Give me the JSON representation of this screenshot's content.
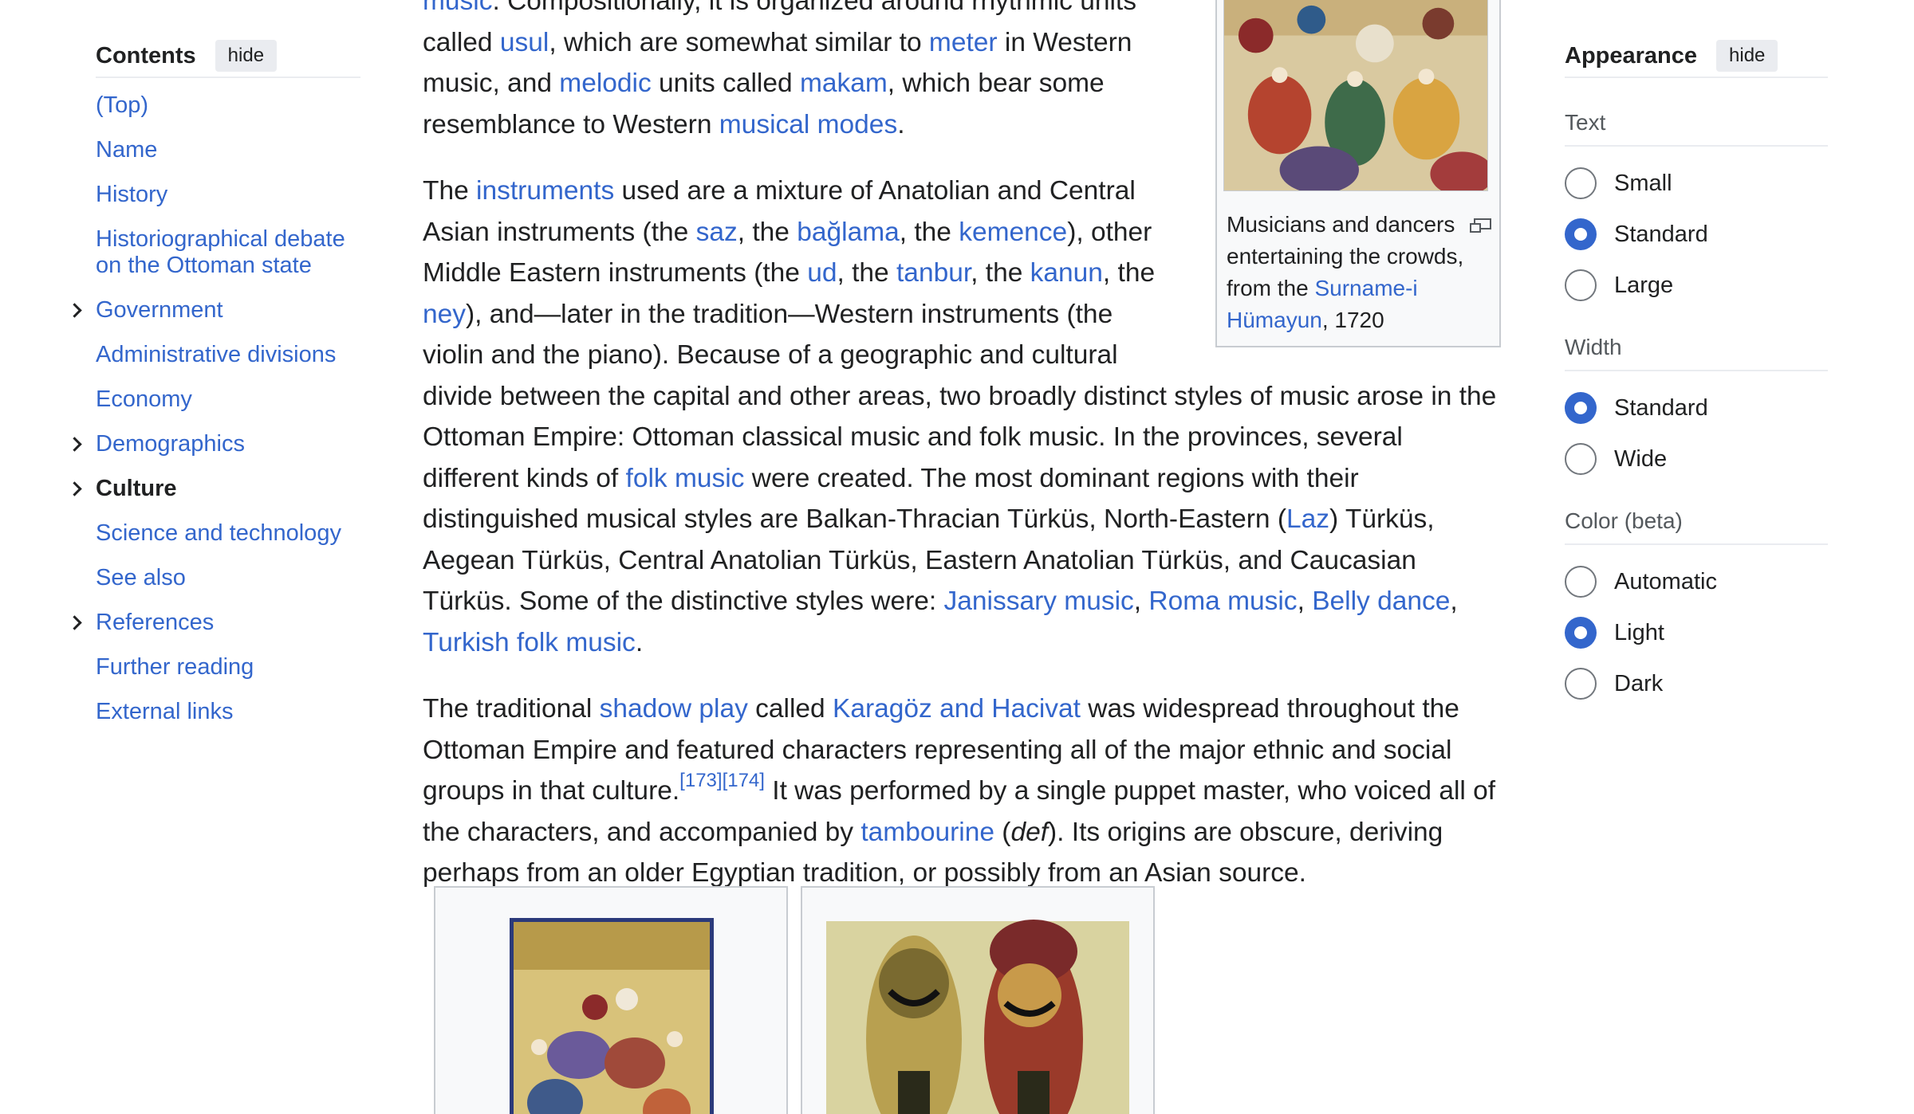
{
  "toc": {
    "title": "Contents",
    "hide_label": "hide",
    "items": [
      {
        "label": "(Top)"
      },
      {
        "label": "Name"
      },
      {
        "label": "History"
      },
      {
        "label": "Historiographical debate on the Ottoman state"
      },
      {
        "label": "Government"
      },
      {
        "label": "Administrative divisions"
      },
      {
        "label": "Economy"
      },
      {
        "label": "Demographics"
      },
      {
        "label": "Culture"
      },
      {
        "label": "Science and technology"
      },
      {
        "label": "See also"
      },
      {
        "label": "References"
      },
      {
        "label": "Further reading"
      },
      {
        "label": "External links"
      }
    ]
  },
  "article": {
    "p1": {
      "l_music": "music",
      "t1": ". Compositionally, it is organized around rhythmic units called ",
      "l_usul": "usul",
      "t2": ", which are somewhat similar to ",
      "l_meter": "meter",
      "t3": " in Western music, and ",
      "l_melodic": "melodic",
      "t4": " units called ",
      "l_makam": "makam",
      "t5": ", which bear some resemblance to Western ",
      "l_modes": "musical modes",
      "t6": "."
    },
    "p2": {
      "t0": "The ",
      "l_instruments": "instruments",
      "t1": " used are a mixture of Anatolian and Central Asian instruments (the ",
      "l_saz": "saz",
      "t2": ", the ",
      "l_baglama": "bağlama",
      "t3": ", the ",
      "l_kemence": "kemence",
      "t4": "), other Middle Eastern instruments (the ",
      "l_ud": "ud",
      "t5": ", the ",
      "l_tanbur": "tanbur",
      "t6": ", the ",
      "l_kanun": "kanun",
      "t7": ", the ",
      "l_ney": "ney",
      "t8": "), and—later in the tradition—Western instruments (the violin and the piano). Because of a geographic and cultural divide between the capital and other areas, two broadly distinct styles of music arose in the Ottoman Empire: Ottoman classical music and folk music. In the provinces, several different kinds of ",
      "l_folk": "folk music",
      "t9": " were created. The most dominant regions with their distinguished musical styles are Balkan-Thracian Türküs, North-Eastern (",
      "l_laz": "Laz",
      "t10": ") Türküs, Aegean Türküs, Central Anatolian Türküs, Eastern Anatolian Türküs, and Caucasian Türküs. Some of the distinctive styles were: ",
      "l_janissary": "Janissary music",
      "t11": ", ",
      "l_roma": "Roma music",
      "t12": ", ",
      "l_belly": "Belly dance",
      "t13": ", ",
      "l_turkish": "Turkish folk music",
      "t14": "."
    },
    "p3": {
      "t0": "The traditional ",
      "l_shadow": "shadow play",
      "t1": " called ",
      "l_karagoz": "Karagöz and Hacivat",
      "t2": " was widespread throughout the Ottoman Empire and featured characters representing all of the major ethnic and social groups in that culture.",
      "ref1": "[173]",
      "ref2": "[174]",
      "t3": " It was performed by a single puppet master, who voiced all of the characters, and accompanied by ",
      "l_tambourine": "tambourine",
      "t4": " (",
      "def": "def",
      "t5": "). Its origins are obscure, deriving perhaps from an older Egyptian tradition, or possibly from an Asian source."
    },
    "figure": {
      "caption_t1": "Musicians and dancers entertaining the crowds, from the ",
      "caption_link": "Surname-i Hümayun",
      "caption_t2": ", 1720"
    }
  },
  "appearance": {
    "title": "Appearance",
    "hide_label": "hide",
    "groups": [
      {
        "label": "Text",
        "options": [
          {
            "label": "Small"
          },
          {
            "label": "Standard",
            "selected": true
          },
          {
            "label": "Large"
          }
        ]
      },
      {
        "label": "Width",
        "options": [
          {
            "label": "Standard",
            "selected": true
          },
          {
            "label": "Wide"
          }
        ]
      },
      {
        "label": "Color (beta)",
        "options": [
          {
            "label": "Automatic"
          },
          {
            "label": "Light",
            "selected": true
          },
          {
            "label": "Dark"
          }
        ]
      }
    ]
  },
  "colors": {
    "link": "#3366cc",
    "text": "#202122",
    "border": "#c8ccd1",
    "radio_selected": "#3366cc"
  },
  "icons": [
    "chevron-right-icon",
    "magnify-icon"
  ]
}
